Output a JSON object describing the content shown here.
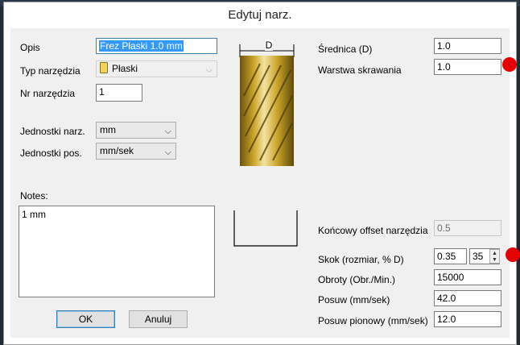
{
  "window": {
    "title": "Edytuj narz."
  },
  "fields": {
    "opis_label": "Opis",
    "opis_value": "Frez Płaski 1.0  mm",
    "typ_label": "Typ narzędzia",
    "typ_value": "Płaski",
    "nr_label": "Nr narzędzia",
    "nr_value": "1",
    "jedn_narz_label": "Jednostki narz.",
    "jedn_narz_value": "mm",
    "jedn_pos_label": "Jednostki pos.",
    "jedn_pos_value": "mm/sek",
    "notes_label": "Notes:",
    "notes_value": "1 mm"
  },
  "tool_diagram": {
    "dim_label": "D"
  },
  "right_fields": {
    "srednica_label": "Średnica (D)",
    "srednica_value": "1.0",
    "warstwa_label": "Warstwa skrawania",
    "warstwa_value": "1.0",
    "offset_label": "Końcowy offset narzędzia",
    "offset_value": "0.5",
    "skok_label": "Skok (rozmiar, % D)",
    "skok_value": "0.35",
    "skok_percent": "35",
    "obroty_label": "Obroty (Obr./Min.)",
    "obroty_value": "15000",
    "posuw_label": "Posuw (mm/sek)",
    "posuw_value": "42.0",
    "posuw_pion_label": "Posuw pionowy (mm/sek)",
    "posuw_pion_value": "12.0"
  },
  "buttons": {
    "ok": "OK",
    "cancel": "Anuluj"
  },
  "colors": {
    "accent": "#3c7fb1",
    "marker": "#e60000",
    "tool_gold": "#c9a227"
  }
}
